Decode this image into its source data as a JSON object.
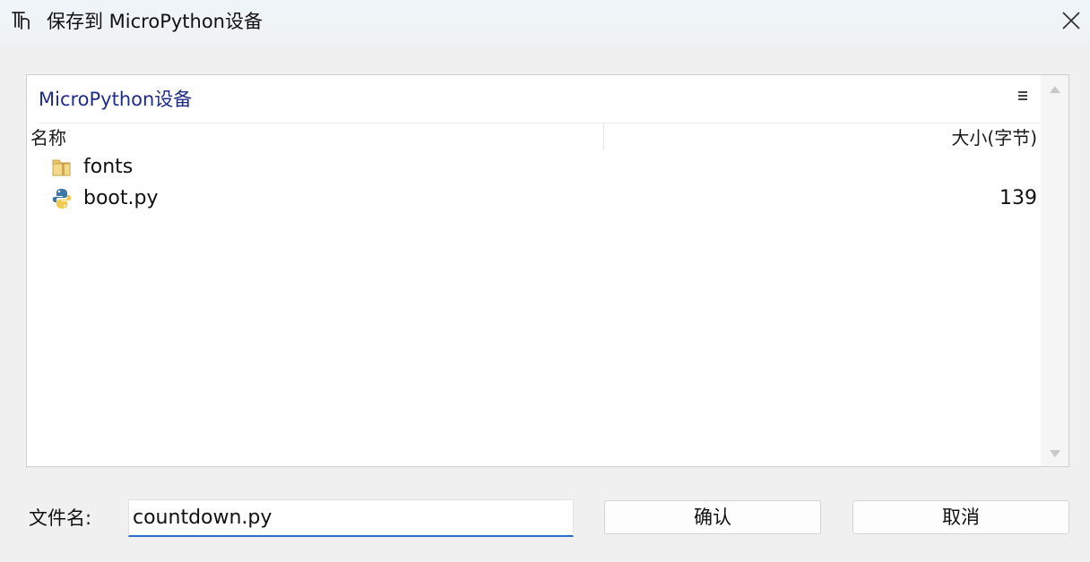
{
  "window": {
    "title": "保存到 MicroPython设备",
    "app_icon": "thonny-logo-icon",
    "close_icon": "close-icon"
  },
  "browser": {
    "path": "MicroPython设备",
    "menu_icon": "menu-icon",
    "columns": {
      "name": "名称",
      "size": "大小(字节)"
    },
    "rows": [
      {
        "name": "fonts",
        "size": "",
        "icon": "folder-icon"
      },
      {
        "name": "boot.py",
        "size": "139",
        "icon": "python-file-icon"
      }
    ]
  },
  "footer": {
    "filename_label": "文件名:",
    "filename_value": "countdown.py",
    "ok_label": "确认",
    "cancel_label": "取消"
  },
  "colors": {
    "path_text": "#1f2d8a",
    "input_focus": "#2a6fc9",
    "background": "#f0f0f0"
  }
}
